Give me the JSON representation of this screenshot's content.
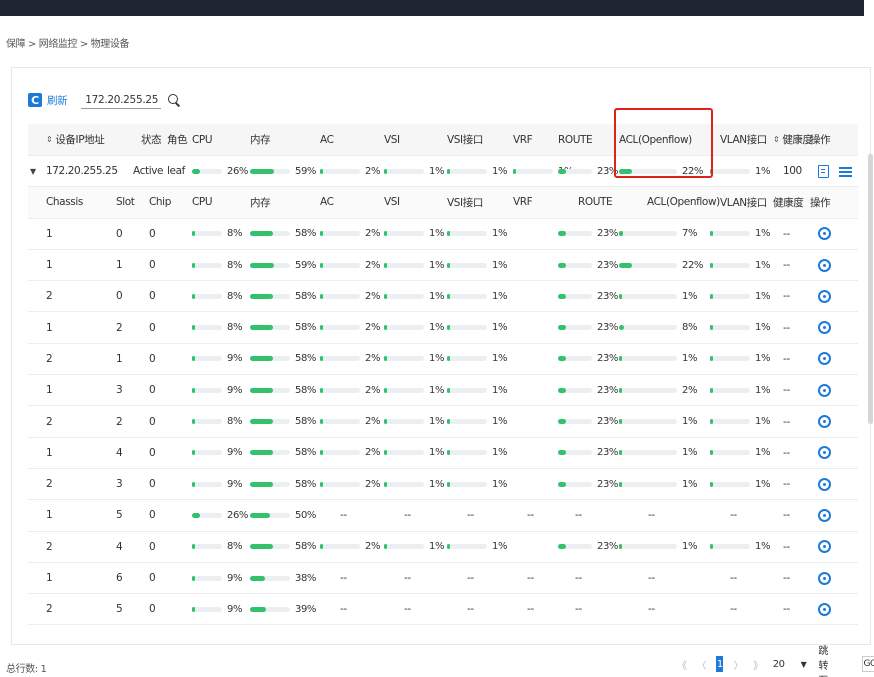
{
  "breadcrumb": "保障 > 网络监控 > 物理设备",
  "toolbar": {
    "refresh_label": "刷新",
    "search_value": "172.20.255.25"
  },
  "colors": {
    "accent": "#1d7bd8",
    "bar_fill": "#34c16b",
    "highlight": "#e0201b"
  },
  "table": {
    "headers": [
      "设备IP地址",
      "状态",
      "角色",
      "CPU",
      "内存",
      "AC",
      "VSI",
      "VSI接口",
      "VRF",
      "ROUTE",
      "ACL(Openflow)",
      "VLAN接口",
      "健康度",
      "操作"
    ],
    "device": {
      "ip": "172.20.255.25",
      "status": "Active",
      "role": "leaf",
      "cpu": 26,
      "mem": 59,
      "ac": 2,
      "vsi": 1,
      "vsi_if": 1,
      "vrf": 1,
      "route": 23,
      "acl": 22,
      "vlan": 1,
      "health": "100"
    },
    "sub_headers": [
      "Chassis",
      "Slot",
      "Chip",
      "CPU",
      "内存",
      "AC",
      "VSI",
      "VSI接口",
      "VRF",
      "ROUTE",
      "ACL(Openflow)",
      "VLAN接口",
      "健康度",
      "操作"
    ],
    "rows": [
      {
        "chassis": "1",
        "slot": "0",
        "chip": "0",
        "cpu": 8,
        "mem": 58,
        "ac": 2,
        "vsi": 1,
        "vsi_if": 1,
        "route": 23,
        "acl": 7,
        "vlan": 1,
        "health": "--"
      },
      {
        "chassis": "1",
        "slot": "1",
        "chip": "0",
        "cpu": 8,
        "mem": 59,
        "ac": 2,
        "vsi": 1,
        "vsi_if": 1,
        "route": 23,
        "acl": 22,
        "vlan": 1,
        "health": "--"
      },
      {
        "chassis": "2",
        "slot": "0",
        "chip": "0",
        "cpu": 8,
        "mem": 58,
        "ac": 2,
        "vsi": 1,
        "vsi_if": 1,
        "route": 23,
        "acl": 1,
        "vlan": 1,
        "health": "--"
      },
      {
        "chassis": "1",
        "slot": "2",
        "chip": "0",
        "cpu": 8,
        "mem": 58,
        "ac": 2,
        "vsi": 1,
        "vsi_if": 1,
        "route": 23,
        "acl": 8,
        "vlan": 1,
        "health": "--"
      },
      {
        "chassis": "2",
        "slot": "1",
        "chip": "0",
        "cpu": 9,
        "mem": 58,
        "ac": 2,
        "vsi": 1,
        "vsi_if": 1,
        "route": 23,
        "acl": 1,
        "vlan": 1,
        "health": "--"
      },
      {
        "chassis": "1",
        "slot": "3",
        "chip": "0",
        "cpu": 9,
        "mem": 58,
        "ac": 2,
        "vsi": 1,
        "vsi_if": 1,
        "route": 23,
        "acl": 2,
        "vlan": 1,
        "health": "--"
      },
      {
        "chassis": "2",
        "slot": "2",
        "chip": "0",
        "cpu": 8,
        "mem": 58,
        "ac": 2,
        "vsi": 1,
        "vsi_if": 1,
        "route": 23,
        "acl": 1,
        "vlan": 1,
        "health": "--"
      },
      {
        "chassis": "1",
        "slot": "4",
        "chip": "0",
        "cpu": 9,
        "mem": 58,
        "ac": 2,
        "vsi": 1,
        "vsi_if": 1,
        "route": 23,
        "acl": 1,
        "vlan": 1,
        "health": "--"
      },
      {
        "chassis": "2",
        "slot": "3",
        "chip": "0",
        "cpu": 9,
        "mem": 58,
        "ac": 2,
        "vsi": 1,
        "vsi_if": 1,
        "route": 23,
        "acl": 1,
        "vlan": 1,
        "health": "--"
      },
      {
        "chassis": "1",
        "slot": "5",
        "chip": "0",
        "cpu": 26,
        "mem": 50,
        "ac": null,
        "vsi": null,
        "vsi_if": null,
        "route": null,
        "acl": null,
        "vlan": null,
        "health": "--"
      },
      {
        "chassis": "2",
        "slot": "4",
        "chip": "0",
        "cpu": 8,
        "mem": 58,
        "ac": 2,
        "vsi": 1,
        "vsi_if": 1,
        "route": 23,
        "acl": 1,
        "vlan": 1,
        "health": "--"
      },
      {
        "chassis": "1",
        "slot": "6",
        "chip": "0",
        "cpu": 9,
        "mem": 38,
        "ac": null,
        "vsi": null,
        "vsi_if": null,
        "route": null,
        "acl": null,
        "vlan": null,
        "health": "--"
      },
      {
        "chassis": "2",
        "slot": "5",
        "chip": "0",
        "cpu": 9,
        "mem": 39,
        "ac": null,
        "vsi": null,
        "vsi_if": null,
        "route": null,
        "acl": null,
        "vlan": null,
        "health": "--"
      }
    ],
    "vrf_placeholder": "--"
  },
  "footer": {
    "total": "总行数: 1",
    "page": "1",
    "page_size": "20",
    "jump_label": "跳转至",
    "go_label": "GO"
  }
}
